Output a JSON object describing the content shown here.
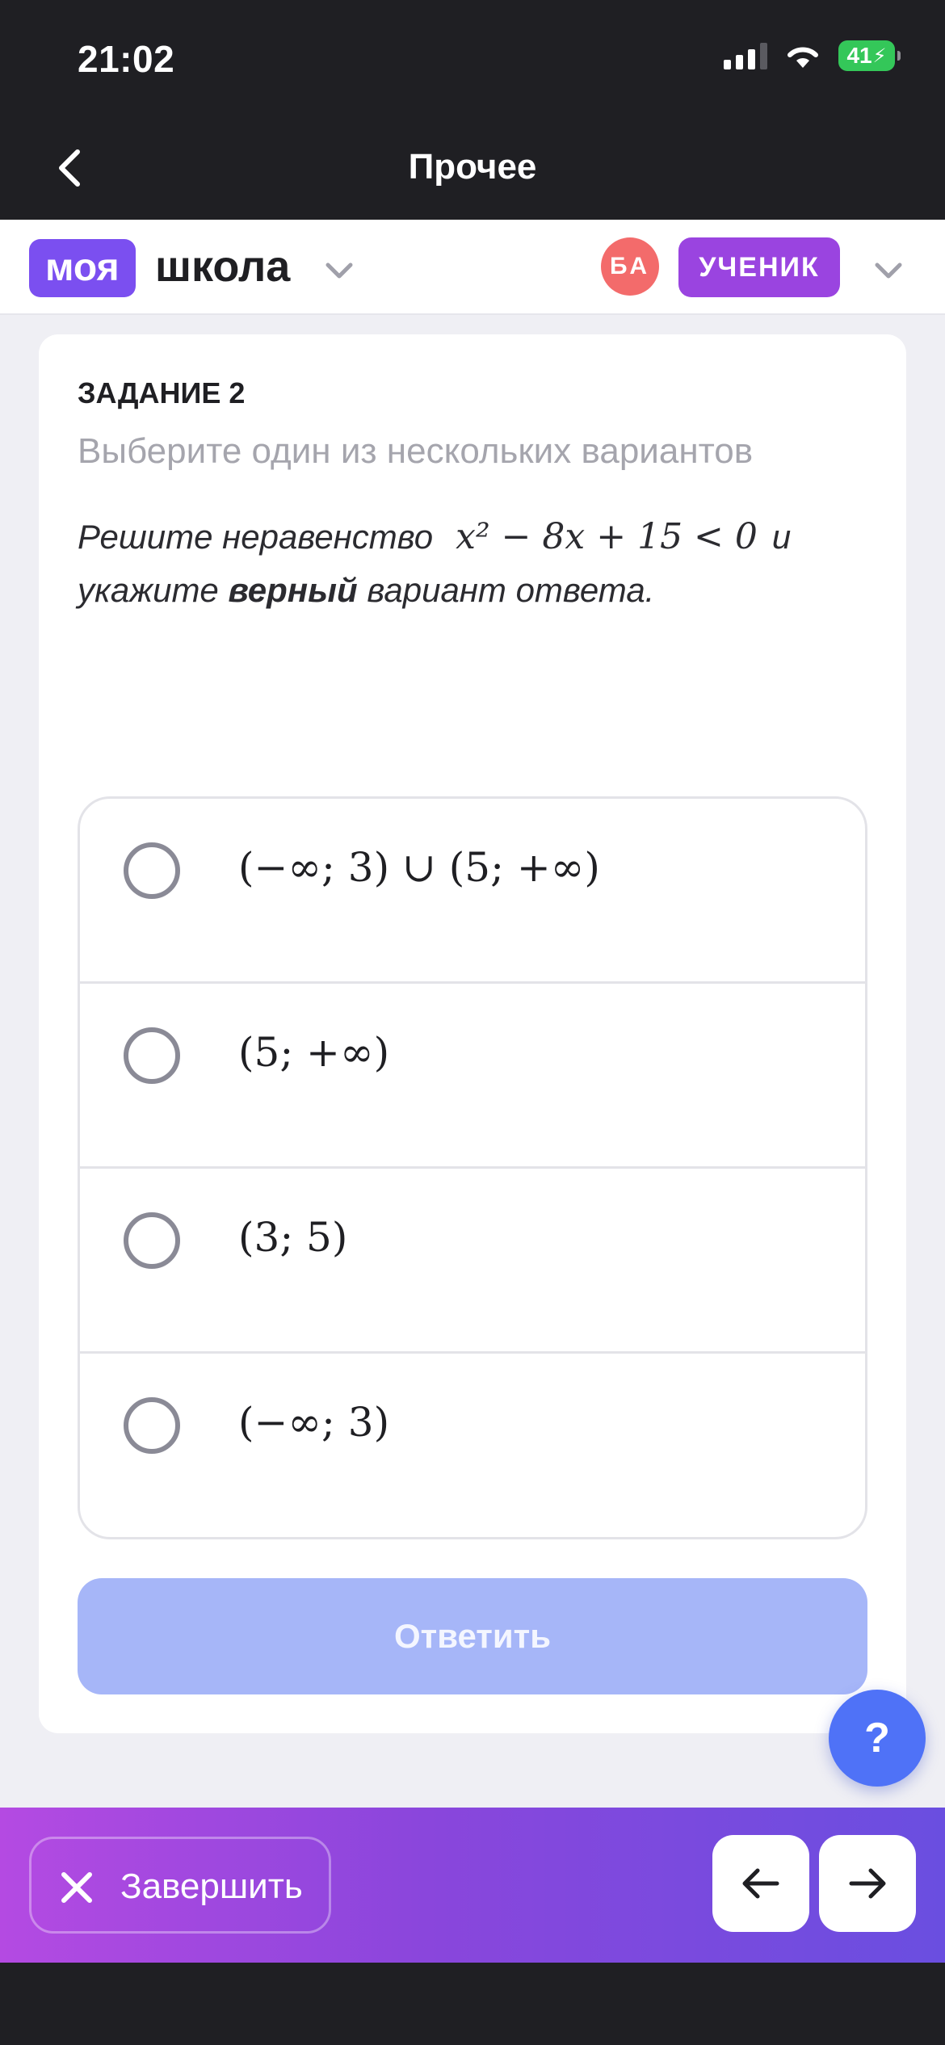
{
  "status_bar": {
    "time": "21:02",
    "battery": "41",
    "icons": [
      "signal-icon",
      "wifi-icon",
      "battery-charging-icon"
    ]
  },
  "nav": {
    "title": "Прочее",
    "back_icon": "chevron-left-icon"
  },
  "header": {
    "logo_part1": "моя",
    "logo_part2": "школа",
    "avatar_initials": "БА",
    "role_label": "УЧЕНИК"
  },
  "task": {
    "label": "ЗАДАНИЕ 2",
    "instruction": "Выберите один из нескольких вариантов",
    "question_prefix": "Решите неравенство",
    "question_formula": "x² − 8x + 15 < 0",
    "question_connector": "и",
    "question_line2_start": "укажите",
    "question_bold": "верный",
    "question_line2_end": "вариант ответа."
  },
  "options": [
    {
      "text": "(−∞; 3) ∪ (5; +∞)",
      "selected": false
    },
    {
      "text": "(5; +∞)",
      "selected": false
    },
    {
      "text": "(3; 5)",
      "selected": false
    },
    {
      "text": "(−∞; 3)",
      "selected": false
    }
  ],
  "answer_button": {
    "label": "Ответить",
    "enabled": false
  },
  "help_button": {
    "label": "?"
  },
  "bottom_bar": {
    "finish_label": "Завершить",
    "prev_icon": "arrow-left-icon",
    "next_icon": "arrow-right-icon"
  },
  "colors": {
    "accent": "#7b4ff0",
    "role_badge": "#9a44e0",
    "avatar": "#f36b6b",
    "answer_disabled": "#a6b6f8",
    "help": "#4f72f7",
    "bar_gradient_start": "#b44ae2",
    "bar_gradient_end": "#6a4ee0"
  }
}
